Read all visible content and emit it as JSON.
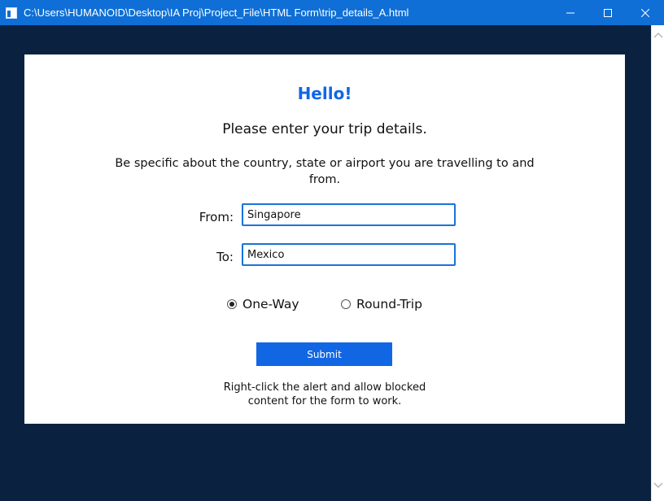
{
  "window": {
    "title": "C:\\Users\\HUMANOID\\Desktop\\IA Proj\\Project_File\\HTML Form\\trip_details_A.html",
    "controls": [
      "minimize-icon",
      "maximize-icon",
      "close-icon"
    ],
    "titlebar_color": "#0f6fd6"
  },
  "page": {
    "backdrop_color": "#0a2240",
    "heading": "Hello!",
    "subheading": "Please enter your trip details.",
    "instruction": "Be specific about the country, state or airport you are travelling to and from.",
    "accent_color": "#1166e4"
  },
  "form": {
    "from": {
      "label": "From:",
      "value": "Singapore"
    },
    "to": {
      "label": "To:",
      "value": "Mexico"
    },
    "trip_type": {
      "options": [
        {
          "label": "One-Way",
          "selected": true
        },
        {
          "label": "Round-Trip",
          "selected": false
        }
      ]
    },
    "submit_label": "Submit"
  },
  "footnote": "Right-click the alert and allow blocked content for the form to work."
}
